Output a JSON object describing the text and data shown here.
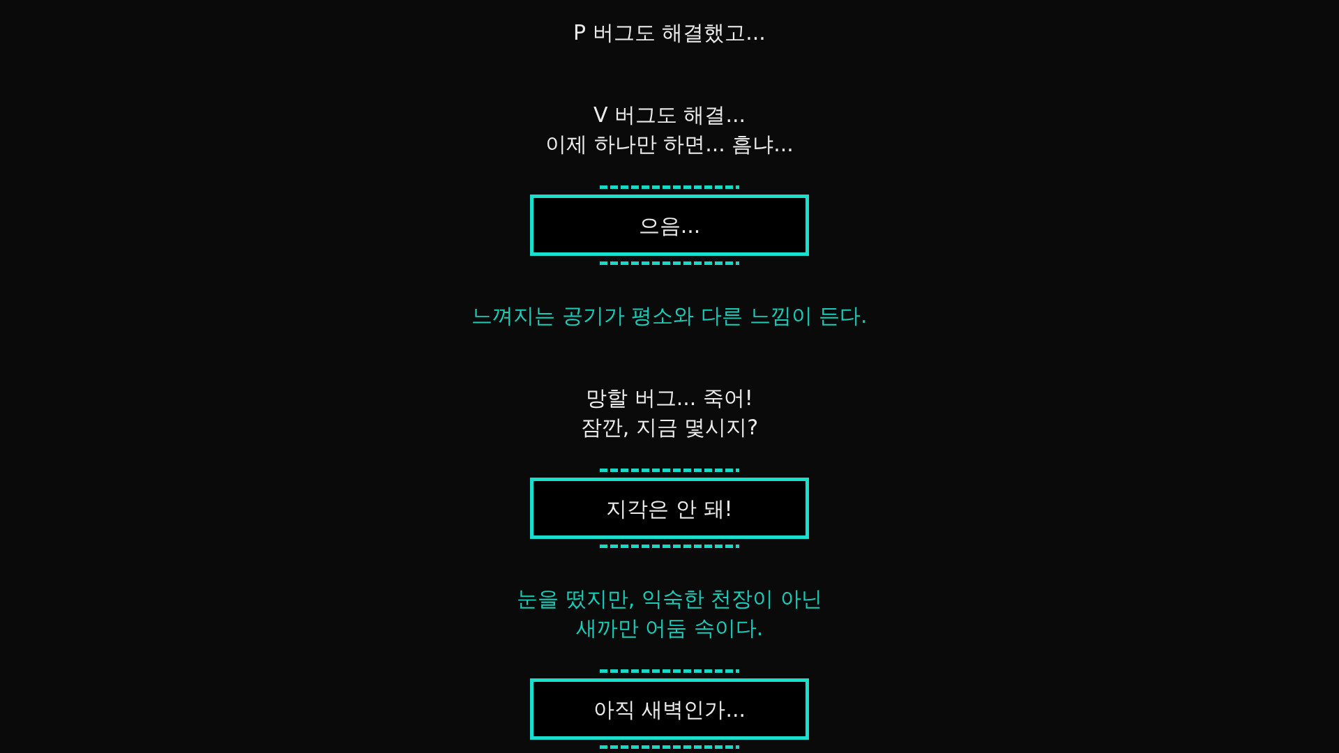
{
  "script": [
    {
      "kind": "dialogue",
      "lines": [
        "P 버그도 해결했고..."
      ]
    },
    {
      "kind": "dialogue",
      "lines": [
        "V 버그도 해결...",
        "이제 하나만 하면... 흠냐..."
      ]
    },
    {
      "kind": "choice",
      "label": "으음..."
    },
    {
      "kind": "narration",
      "lines": [
        "느껴지는 공기가 평소와 다른 느낌이 든다."
      ]
    },
    {
      "kind": "dialogue",
      "lines": [
        "망할 버그... 죽어!",
        "잠깐, 지금 몇시지?"
      ]
    },
    {
      "kind": "choice",
      "label": "지각은 안 돼!"
    },
    {
      "kind": "narration",
      "lines": [
        "눈을 떴지만, 익숙한 천장이 아닌",
        "새까만 어둠 속이다."
      ]
    },
    {
      "kind": "choice",
      "label": "아직 새벽인가..."
    }
  ]
}
